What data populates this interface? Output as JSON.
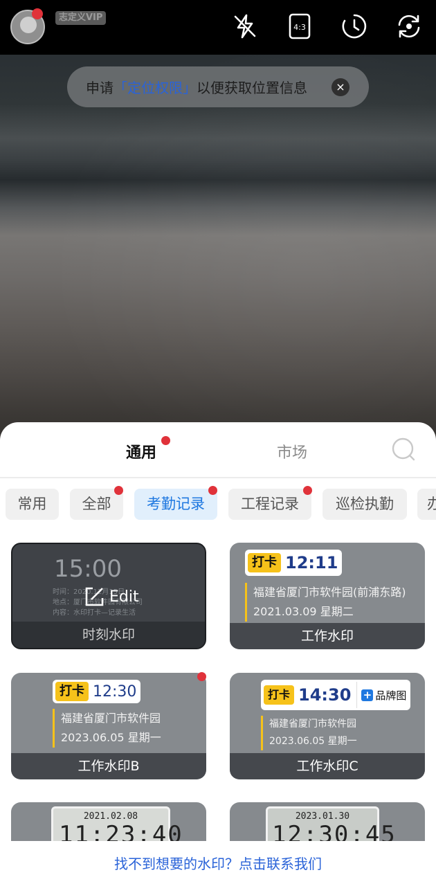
{
  "topbar": {
    "vip_badge": "志定义VIP",
    "icons": [
      "flash-off-icon",
      "aspect-ratio-icon",
      "timer-icon",
      "switch-camera-icon"
    ],
    "aspect_label": "4:3"
  },
  "toast": {
    "prefix": "申请",
    "link": "「定位权限」",
    "suffix": "以便获取位置信息",
    "close": "×"
  },
  "sheet": {
    "tabs": [
      {
        "label": "通用",
        "active": true,
        "has_dot": true
      },
      {
        "label": "市场",
        "active": false,
        "has_dot": false
      }
    ],
    "chips": [
      {
        "label": "常用",
        "active": false
      },
      {
        "label": "全部",
        "active": false
      },
      {
        "label": "考勤记录",
        "active": true
      },
      {
        "label": "工程记录",
        "active": false
      },
      {
        "label": "巡检执勤",
        "active": false
      },
      {
        "label": "办",
        "active": false
      }
    ],
    "cards": {
      "time_wm": {
        "label": "时刻水印",
        "time": "15:00",
        "line1": "时间：2020.12月15日",
        "line2": "地点：厦门市软件园有限公司",
        "line3": "内容：水印打卡—记录生活",
        "edit": "Edit"
      },
      "work_wm": {
        "label": "工作水印",
        "tag": "打卡",
        "time": "12:11",
        "address": "福建省厦门市软件园(前浦东路)",
        "date": "2021.03.09 星期二"
      },
      "work_wm_b": {
        "label": "工作水印B",
        "tag": "打卡",
        "time": "12:30",
        "address": "福建省厦门市软件园",
        "date": "2023.06.05 星期一"
      },
      "work_wm_c": {
        "label": "工作水印C",
        "tag": "打卡",
        "time": "14:30",
        "brand": "品牌图",
        "address": "福建省厦门市软件园",
        "date": "2023.06.05 星期一"
      },
      "clock_1": {
        "date": "2021.02.08",
        "time": "11:23:40"
      },
      "clock_2": {
        "date": "2023.01.30",
        "time": "12:30:45"
      }
    },
    "footer_link": "找不到想要的水印？点击联系我们"
  }
}
